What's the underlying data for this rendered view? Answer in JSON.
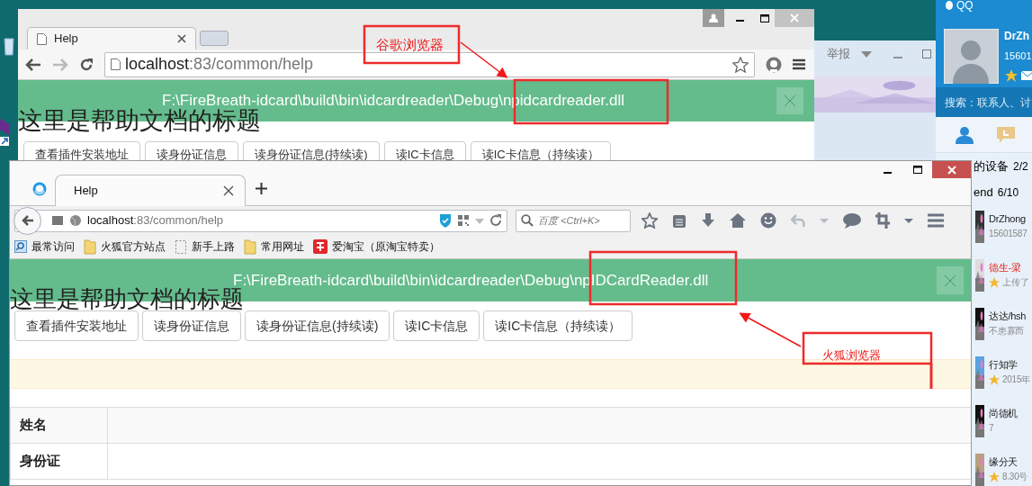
{
  "chrome_window": {
    "tab": {
      "title": "Help"
    },
    "address": {
      "host": "localhost",
      "path": ":83/common/help"
    },
    "notification": {
      "message": "F:\\FireBreath-idcard\\build\\bin\\idcardreader\\Debug\\npidcardreader.dll"
    },
    "heading": "这里是帮助文档的标题",
    "buttons": [
      "查看插件安装地址",
      "读身份证信息",
      "读身份证信息(持续读)",
      "读IC卡信息",
      "读IC卡信息（持续读）"
    ]
  },
  "background_window": {
    "menu": "举报"
  },
  "firefox_window": {
    "tab": {
      "title": "Help"
    },
    "address": {
      "host": "localhost",
      "path": ":83/common/help"
    },
    "search": {
      "placeholder": "百度 <Ctrl+K>"
    },
    "bookmarks": [
      {
        "kind": "search",
        "label": "最常访问"
      },
      {
        "kind": "folder",
        "label": "火狐官方站点"
      },
      {
        "kind": "blank",
        "label": "新手上路"
      },
      {
        "kind": "folder",
        "label": "常用网址"
      },
      {
        "kind": "shop",
        "label": "爱淘宝（原淘宝特卖）"
      }
    ],
    "notification": {
      "message": "F:\\FireBreath-idcard\\build\\bin\\idcardreader\\Debug\\npIDCardReader.dll"
    },
    "heading": "这里是帮助文档的标题",
    "buttons": [
      "查看插件安装地址",
      "读身份证信息",
      "读身份证信息(持续读)",
      "读IC卡信息",
      "读IC卡信息（持续读）"
    ],
    "table": {
      "rows": [
        {
          "label": "姓名"
        },
        {
          "label": "身份证"
        }
      ]
    }
  },
  "annotations": [
    {
      "label": "谷歌浏览器"
    },
    {
      "label": "火狐浏览器"
    }
  ],
  "qq_panel": {
    "title": "QQ",
    "nickname": "DrZh",
    "number": "15601",
    "search": {
      "placeholder": "搜索：联系人、讨"
    },
    "groups": [
      {
        "label": "的设备",
        "count": "2/2"
      },
      {
        "label": "end",
        "count": "6/10"
      }
    ],
    "contacts": [
      {
        "name": "DrZhong",
        "status": "15601587",
        "starred": false,
        "highlighted": false
      },
      {
        "name": "德生-梁",
        "status": "上传了",
        "starred": true,
        "highlighted": true
      },
      {
        "name": "达达/hsh",
        "status": "不患寡而",
        "starred": false,
        "highlighted": false
      },
      {
        "name": "行知学",
        "status": "2015年",
        "starred": true,
        "highlighted": false
      },
      {
        "name": "尚德机",
        "status": "7",
        "starred": false,
        "highlighted": false
      },
      {
        "name": "缘分天",
        "status": "8.30号",
        "starred": true,
        "highlighted": false
      }
    ]
  }
}
